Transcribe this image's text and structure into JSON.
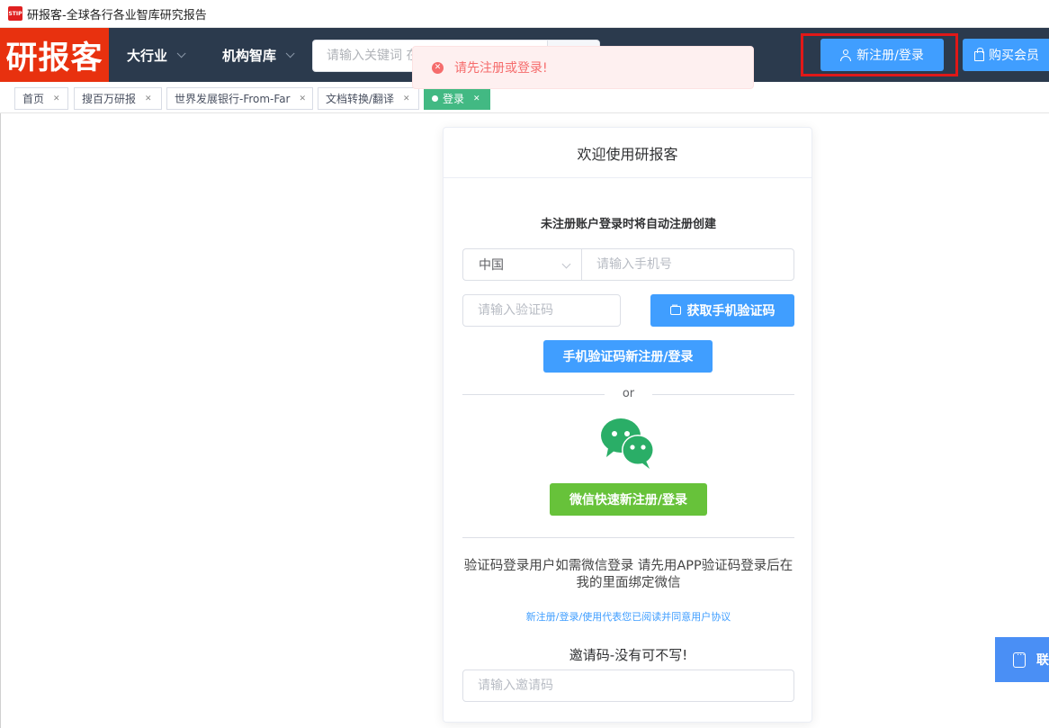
{
  "window": {
    "title": "研报客-全球各行各业智库研究报告",
    "icon_text": "STIP"
  },
  "header": {
    "brand": "研报客",
    "nav": [
      {
        "label": "大行业"
      },
      {
        "label": "机构智库"
      }
    ],
    "search_placeholder": "请输入关键词 在",
    "register_label": "新注册/登录",
    "buy_label": "购买会员"
  },
  "toast": {
    "message": "请先注册或登录!"
  },
  "tabs": [
    {
      "label": "首页"
    },
    {
      "label": "搜百万研报"
    },
    {
      "label": "世界发展银行-From-Far"
    },
    {
      "label": "文档转换/翻译"
    },
    {
      "label": "登录",
      "active": true
    }
  ],
  "login_card": {
    "title": "欢迎使用研报客",
    "notice": "未注册账户登录时将自动注册创建",
    "region": "中国",
    "phone_placeholder": "请输入手机号",
    "code_placeholder": "请输入验证码",
    "get_code_label": "获取手机验证码",
    "phone_login_label": "手机验证码新注册/登录",
    "or_text": "or",
    "wechat_login_label": "微信快速新注册/登录",
    "tip": "验证码登录用户如需微信登录 请先用APP验证码登录后在我的里面绑定微信",
    "agreement": "新注册/登录/使用代表您已阅读并同意用户协议",
    "invite_title": "邀请码-没有可不写!",
    "invite_placeholder": "请输入邀请码"
  },
  "float_contact": {
    "label": "联"
  },
  "colors": {
    "brand": "#e8310f",
    "header_bg": "#2b3a4d",
    "primary": "#409eff",
    "wechat": "#67c23a",
    "tab_active": "#42b983",
    "error": "#f56c6c"
  }
}
